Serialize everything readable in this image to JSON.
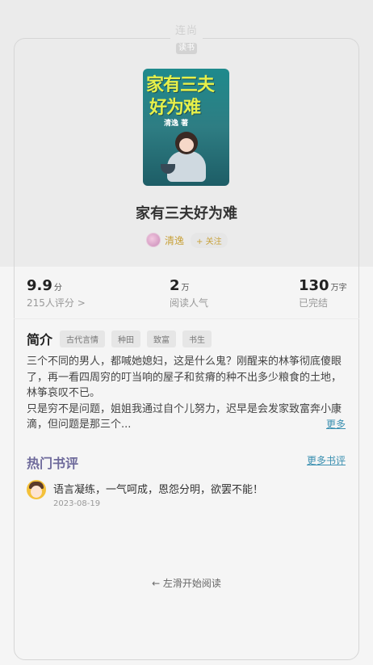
{
  "brand": {
    "line1": "连尚",
    "line2": "读书"
  },
  "book": {
    "cover_title_line1": "家有三夫",
    "cover_title_line2": "好为难",
    "cover_author": "清逸 著",
    "title": "家有三夫好为难",
    "author": "清逸",
    "follow_label": "+ 关注"
  },
  "stats": [
    {
      "value": "9.9",
      "unit": "分",
      "label": "215人评分 >"
    },
    {
      "value": "2",
      "unit": "万",
      "label": "阅读人气"
    },
    {
      "value": "130",
      "unit": "万字",
      "label": "已完结"
    }
  ],
  "intro": {
    "label": "简介",
    "tags": [
      "古代言情",
      "种田",
      "致富",
      "书生"
    ],
    "paragraph1": "三个不同的男人，都喊她媳妇，这是什么鬼？刚醒来的林筝彻底傻眼了，再一看四周穷的叮当响的屋子和贫瘠的种不出多少粮食的土地，林筝哀叹不已。",
    "paragraph2": "只是穷不是问题，姐姐我通过自个儿努力，迟早是会发家致富奔小康滴，但问题是那三个...",
    "more_label": "更多"
  },
  "reviews": {
    "title": "热门书评",
    "more_label": "更多书评",
    "items": [
      {
        "text": "语言凝练，一气呵成，恩怨分明，欲罢不能！",
        "date": "2023-08-19"
      }
    ]
  },
  "swipe_hint": "← 左滑开始阅读",
  "colors": {
    "accent_gold": "#c8a13a",
    "section_purple": "#6e6a9b",
    "link_blue": "#3a8fb0"
  }
}
